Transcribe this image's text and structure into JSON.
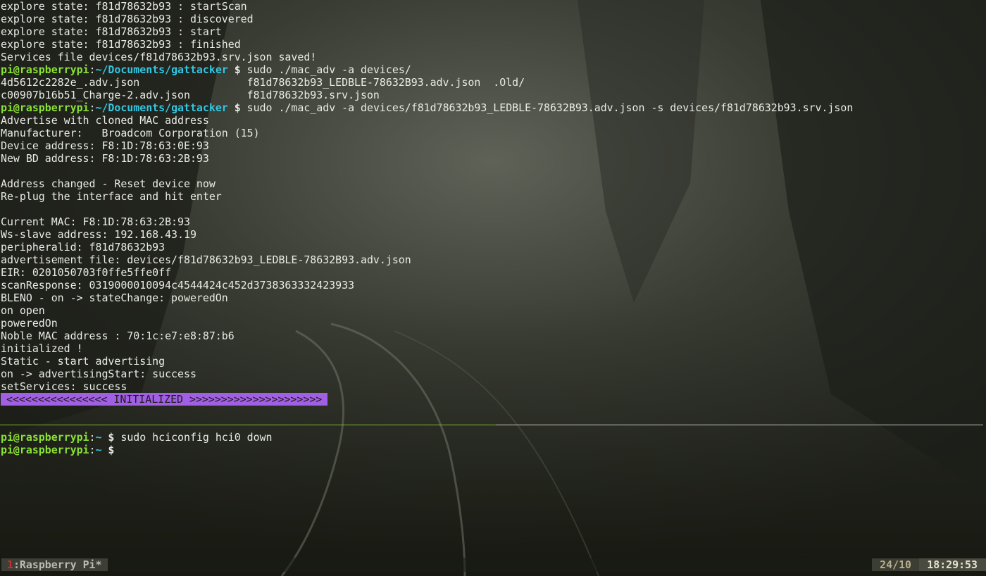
{
  "prompt": {
    "user_host": "pi@raspberrypi",
    "cwd_project": "~/Documents/gattacker",
    "cwd_home": "~",
    "symbol": "$"
  },
  "top_pane": {
    "lines_before": [
      "explore state: f81d78632b93 : startScan",
      "explore state: f81d78632b93 : discovered",
      "explore state: f81d78632b93 : start",
      "explore state: f81d78632b93 : finished",
      "Services file devices/f81d78632b93.srv.json saved!"
    ],
    "cmd1": "sudo ./mac_adv -a devices/",
    "completion_lines": [
      "4d5612c2282e_.adv.json                 f81d78632b93_LEDBLE-78632B93.adv.json  .Old/",
      "c00907b16b51_Charge-2.adv.json         f81d78632b93.srv.json"
    ],
    "cmd2": "sudo ./mac_adv -a devices/f81d78632b93_LEDBLE-78632B93.adv.json -s devices/f81d78632b93.srv.json",
    "output_lines": [
      "Advertise with cloned MAC address",
      "Manufacturer:   Broadcom Corporation (15)",
      "Device address: F8:1D:78:63:0E:93",
      "New BD address: F8:1D:78:63:2B:93",
      "",
      "Address changed - Reset device now",
      "Re-plug the interface and hit enter",
      "",
      "Current MAC: F8:1D:78:63:2B:93",
      "Ws-slave address: 192.168.43.19",
      "peripheralid: f81d78632b93",
      "advertisement file: devices/f81d78632b93_LEDBLE-78632B93.adv.json",
      "EIR: 0201050703f0ffe5ffe0ff",
      "scanResponse: 0319000010094c4544424c452d3738363332423933",
      "BLENO - on -> stateChange: poweredOn",
      "on open",
      "poweredOn",
      "Noble MAC address : 70:1c:e7:e8:87:b6",
      "initialized !",
      "Static - start advertising",
      "on -> advertisingStart: success",
      "setServices: success"
    ],
    "banner": "<<<<<<<<<<<<<<<< INITIALIZED >>>>>>>>>>>>>>>>>>>>>"
  },
  "bottom_pane": {
    "cmd1": "sudo hciconfig hci0 down",
    "cmd2": ""
  },
  "statusbar": {
    "window_index": "1",
    "window_name": ":Raspberry Pi*",
    "ratio": "24/10",
    "clock": "18:29:53"
  },
  "colors": {
    "prompt_user": "#8ae234",
    "prompt_path": "#34c6e0",
    "banner_bg": "#a15fe3",
    "active_divider": "#7dbb2b",
    "window_index": "#cc2d2d"
  }
}
